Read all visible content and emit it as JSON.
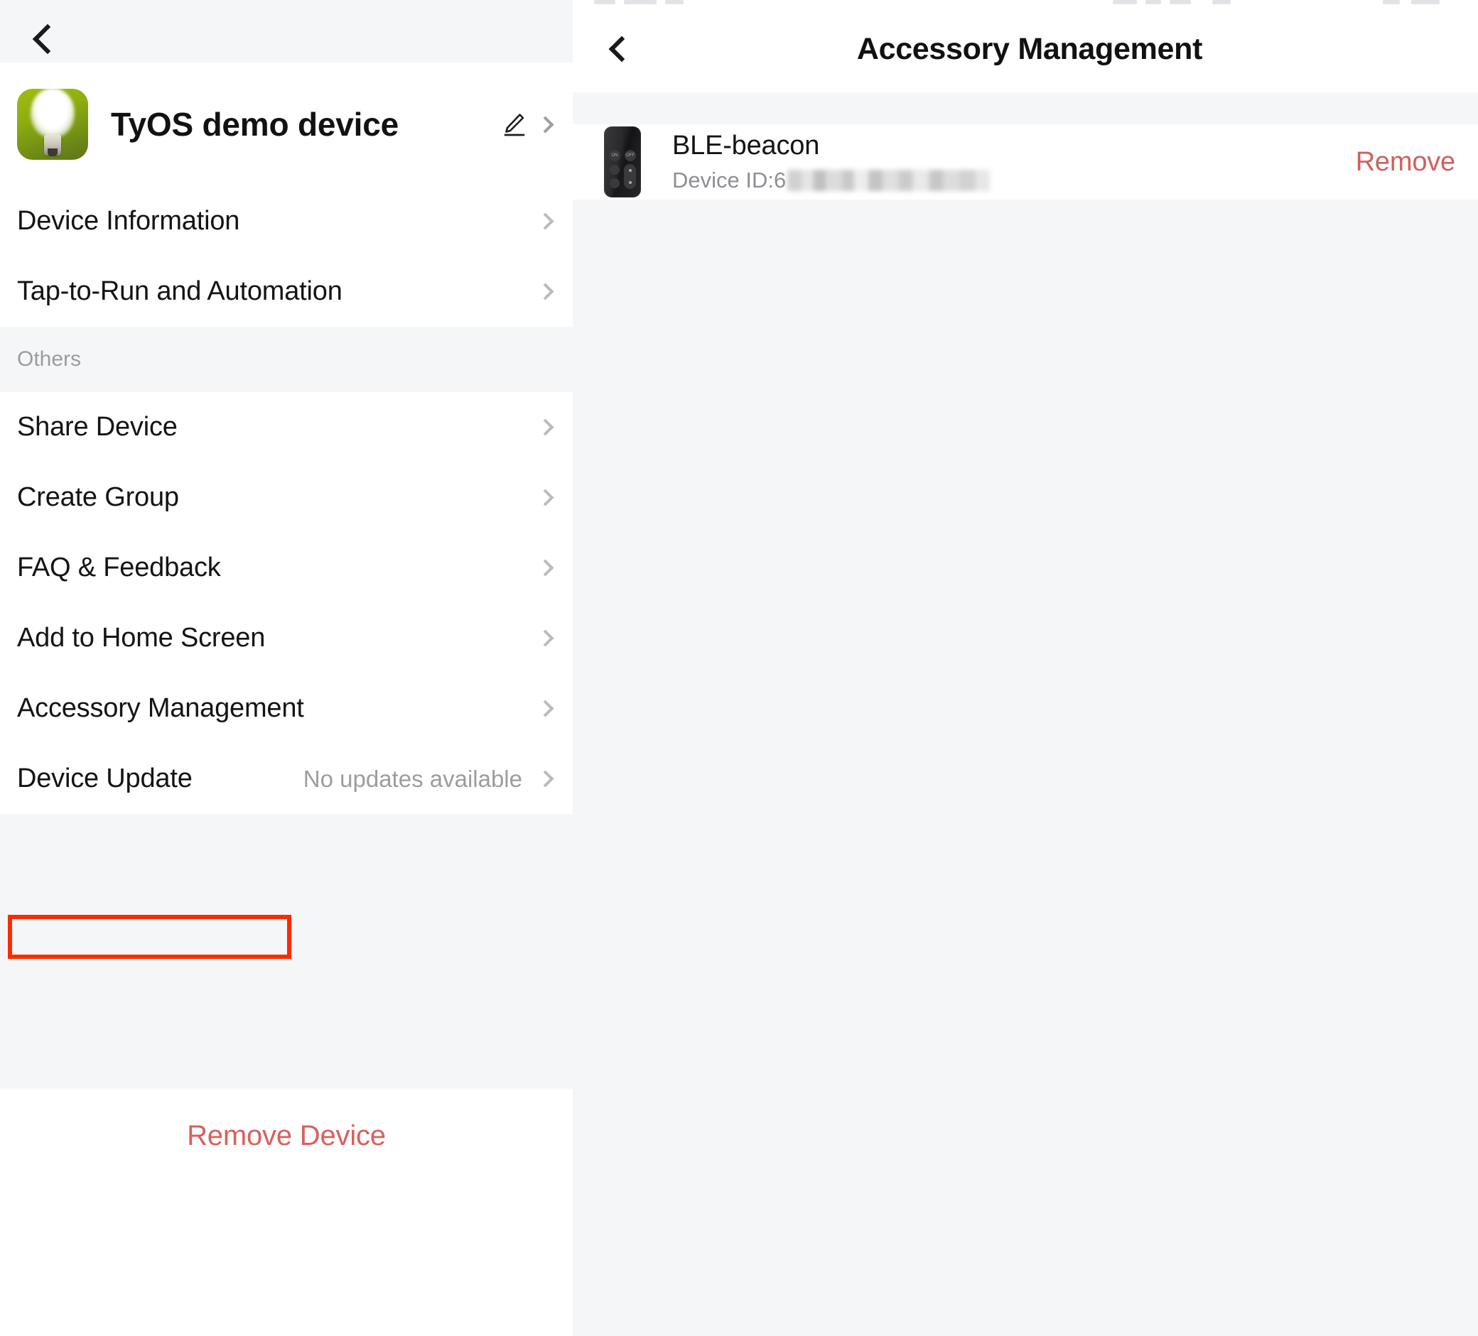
{
  "left_panel": {
    "back_button": "back",
    "device": {
      "name": "TyOS demo device",
      "icon": "lightbulb-icon",
      "edit_icon": "pencil-icon",
      "chevron": "chevron-right-icon"
    },
    "primary_items": [
      {
        "label": "Device Information",
        "value": ""
      },
      {
        "label": "Tap-to-Run and Automation",
        "value": ""
      }
    ],
    "others_section": {
      "title": "Others",
      "items": [
        {
          "label": "Share Device",
          "value": ""
        },
        {
          "label": "Create Group",
          "value": ""
        },
        {
          "label": "FAQ & Feedback",
          "value": ""
        },
        {
          "label": "Add to Home Screen",
          "value": ""
        },
        {
          "label": "Accessory Management",
          "value": "",
          "highlighted": true
        },
        {
          "label": "Device Update",
          "value": "No updates available"
        }
      ]
    },
    "remove_device_label": "Remove Device",
    "highlight_color": "#ff2a00",
    "danger_color": "#d9605c"
  },
  "right_panel": {
    "back_button": "back",
    "title": "Accessory Management",
    "accessories": [
      {
        "icon": "remote-control-icon",
        "name": "BLE-beacon",
        "id_label": "Device ID:6",
        "id_redacted": true,
        "action_label": "Remove"
      }
    ],
    "remote_buttons": {
      "on": "ON",
      "off": "OFF"
    },
    "action_color": "#d0605c"
  }
}
